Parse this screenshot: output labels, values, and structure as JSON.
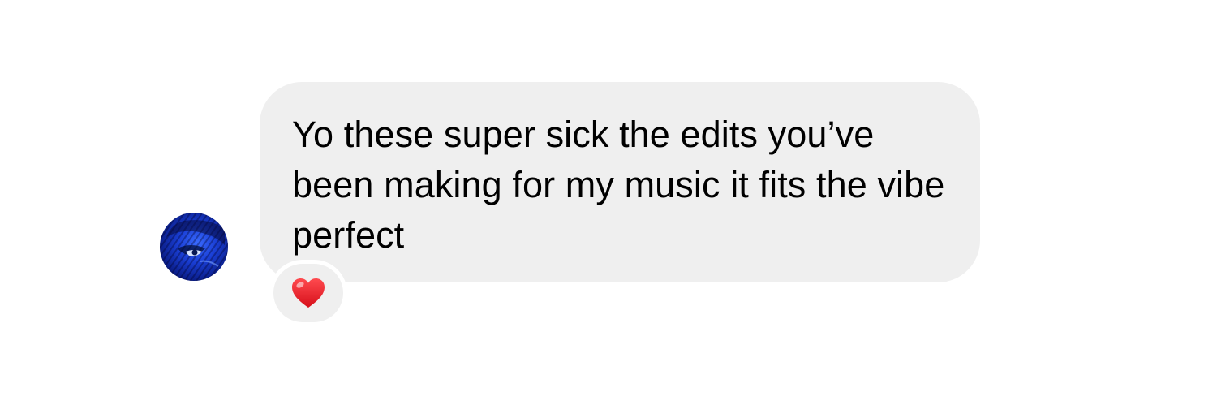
{
  "message": {
    "text": "Yo these super sick the edits you’ve been making for my music it fits the vibe perfect"
  },
  "avatar": {
    "icon": "profile-photo-icon",
    "color": "#1a3fd6"
  },
  "reaction": {
    "icon": "heart-icon",
    "color": "#e0141e"
  },
  "colors": {
    "bubble": "#efefef",
    "background": "#ffffff"
  }
}
